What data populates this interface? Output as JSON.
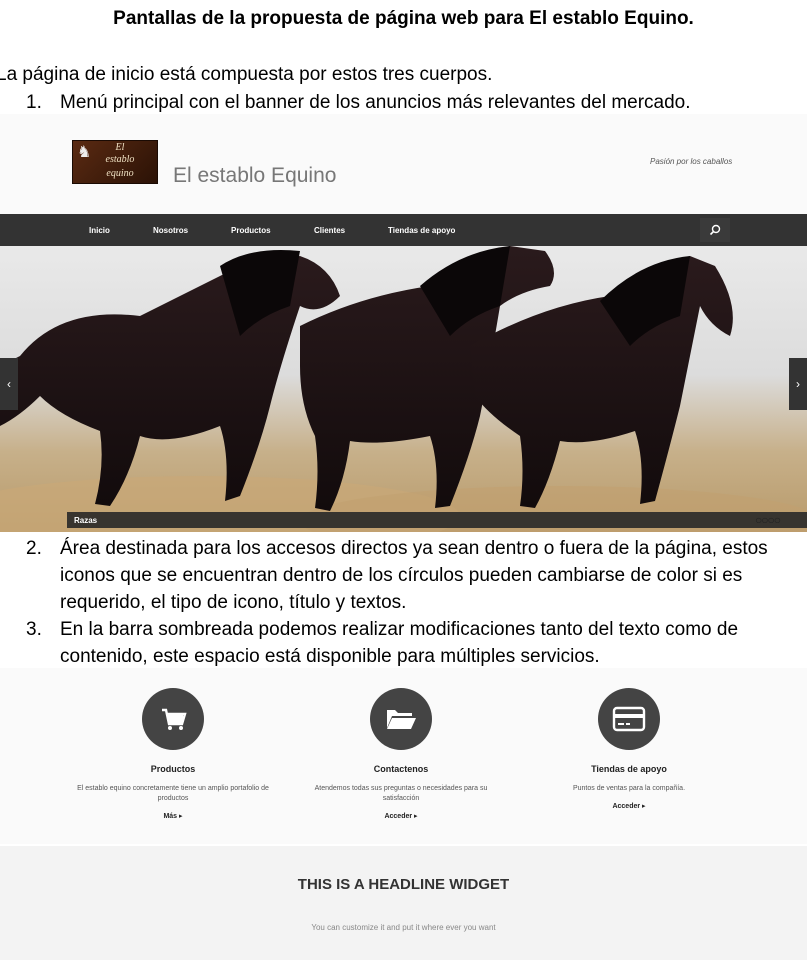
{
  "doc": {
    "title": "Pantallas de la propuesta de página web para El establo Equino.",
    "intro": "La página de inicio está compuesta por estos tres cuerpos.",
    "items": [
      {
        "num": "1.",
        "text": "Menú principal con el banner de los anuncios más relevantes del mercado."
      },
      {
        "num": "2.",
        "text": "Área destinada para los accesos directos ya sean dentro o fuera de la página, estos iconos que se encuentran dentro de los círculos pueden cambiarse de color si es requerido, el tipo de icono, título y textos."
      },
      {
        "num": "3.",
        "text": "En la barra sombreada podemos realizar modificaciones tanto del texto como de contenido, este espacio está disponible para múltiples servicios."
      }
    ]
  },
  "site": {
    "logo_lines": [
      "El",
      "establo",
      "equino"
    ],
    "name": "El establo Equino",
    "tagline": "Pasión por los caballos",
    "nav": [
      "Inicio",
      "Nosotros",
      "Productos",
      "Clientes",
      "Tiendas de apoyo"
    ],
    "slider": {
      "prev": "‹",
      "next": "›",
      "caption": "Razas",
      "dots": "○○○○"
    },
    "features": [
      {
        "icon": "cart-icon",
        "title": "Productos",
        "text": "El establo equino concretamente tiene un amplio portafolio de productos",
        "link": "Más ▸"
      },
      {
        "icon": "folder-open-icon",
        "title": "Contactenos",
        "text": "Atendemos todas sus preguntas o necesidades para su satisfacción",
        "link": "Acceder ▸"
      },
      {
        "icon": "credit-card-icon",
        "title": "Tiendas de apoyo",
        "text": "Puntos de ventas para la compañía.",
        "link": "Acceder ▸"
      }
    ],
    "headline": {
      "title": "THIS IS A HEADLINE WIDGET",
      "sub": "You can customize it and put it where ever you want"
    }
  },
  "colors": {
    "nav_bg": "#333333",
    "circle_bg": "#444444"
  }
}
